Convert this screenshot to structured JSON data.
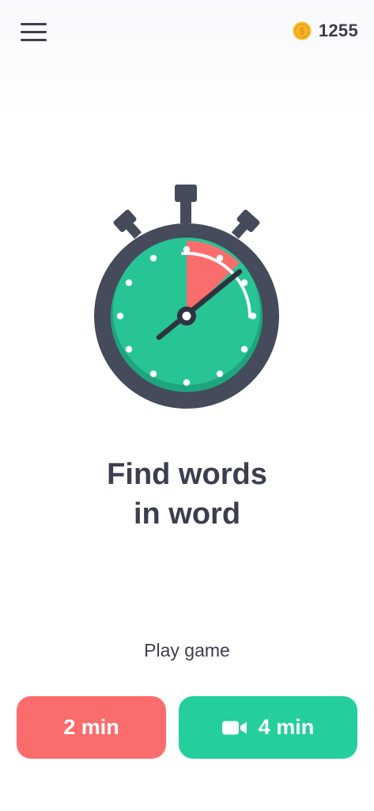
{
  "header": {
    "menu_icon": "hamburger-menu-icon",
    "coin_icon": "dollar-coin-icon",
    "coin_count": "1255"
  },
  "hero": {
    "icon": "stopwatch-icon",
    "title_line1": "Find words",
    "title_line2": "in word"
  },
  "play": {
    "label": "Play game",
    "options": [
      {
        "label": "2 min"
      },
      {
        "label": "4 min",
        "icon": "video-camera-icon"
      }
    ]
  },
  "colors": {
    "text_dark": "#3b3f4d",
    "coin_gold": "#f7b928",
    "button_red": "#fb6d6d",
    "button_green": "#25cf9d",
    "dial_green": "#27c495",
    "dial_red": "#fb6d6d",
    "watch_frame": "#464b5c"
  }
}
